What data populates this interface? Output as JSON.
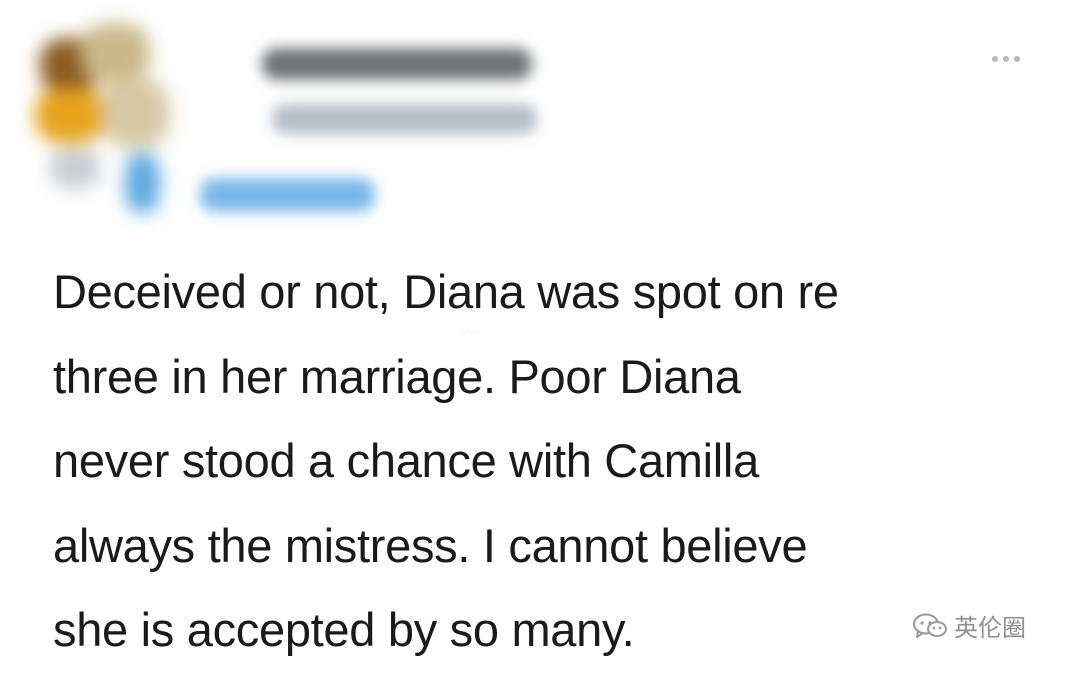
{
  "post": {
    "more_icon": "more-horizontal-icon",
    "text": "Deceived or not, Diana was spot on re\nthree in her marriage.  Poor Diana\nnever stood a chance with Camilla\nalways the mistress.   I cannot believe\nshe is accepted by so many."
  },
  "brand": {
    "icon": "wechat-icon",
    "name": "英伦圈"
  },
  "colors": {
    "text": "#1a1a1a",
    "more_dots": "#b7b9bd",
    "watermark": "#8f8f8f"
  }
}
